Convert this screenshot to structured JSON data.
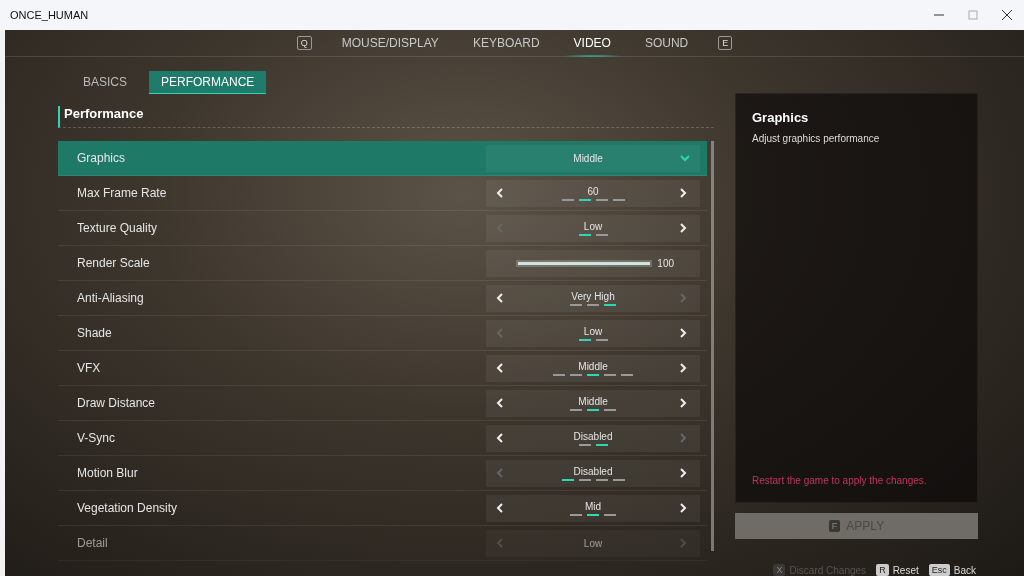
{
  "window": {
    "title": "ONCE_HUMAN"
  },
  "nav": {
    "prev_key": "Q",
    "next_key": "E",
    "tabs": [
      {
        "label": "MOUSE/DISPLAY",
        "selected": false
      },
      {
        "label": "KEYBOARD",
        "selected": false
      },
      {
        "label": "VIDEO",
        "selected": true
      },
      {
        "label": "SOUND",
        "selected": false
      }
    ]
  },
  "subtabs": [
    {
      "label": "BASICS",
      "selected": false
    },
    {
      "label": "PERFORMANCE",
      "selected": true
    }
  ],
  "section_title": "Performance",
  "settings": [
    {
      "kind": "dropdown",
      "label": "Graphics",
      "value": "Middle",
      "selected": true
    },
    {
      "kind": "stepper",
      "label": "Max Frame Rate",
      "value": "60",
      "selected": false,
      "prev_disabled": false,
      "next_disabled": false,
      "steps": [
        {
          "selected": false
        },
        {
          "selected": true
        },
        {
          "selected": false
        },
        {
          "selected": false
        }
      ]
    },
    {
      "kind": "stepper",
      "label": "Texture Quality",
      "value": "Low",
      "selected": false,
      "prev_disabled": true,
      "next_disabled": false,
      "steps": [
        {
          "selected": true
        },
        {
          "selected": false
        }
      ]
    },
    {
      "kind": "slider",
      "label": "Render Scale",
      "value": "100",
      "selected": false,
      "level": 1
    },
    {
      "kind": "stepper",
      "label": "Anti-Aliasing",
      "value": "Very High",
      "selected": false,
      "prev_disabled": false,
      "next_disabled": true,
      "steps": [
        {
          "selected": false
        },
        {
          "selected": false
        },
        {
          "selected": true
        }
      ]
    },
    {
      "kind": "stepper",
      "label": "Shade",
      "value": "Low",
      "selected": false,
      "prev_disabled": true,
      "next_disabled": false,
      "steps": [
        {
          "selected": true
        },
        {
          "selected": false
        }
      ]
    },
    {
      "kind": "stepper",
      "label": "VFX",
      "value": "Middle",
      "selected": false,
      "prev_disabled": false,
      "next_disabled": false,
      "steps": [
        {
          "selected": false
        },
        {
          "selected": false
        },
        {
          "selected": true
        },
        {
          "selected": false
        },
        {
          "selected": false
        }
      ]
    },
    {
      "kind": "stepper",
      "label": "Draw Distance",
      "value": "Middle",
      "selected": false,
      "prev_disabled": false,
      "next_disabled": false,
      "steps": [
        {
          "selected": false
        },
        {
          "selected": true
        },
        {
          "selected": false
        }
      ]
    },
    {
      "kind": "stepper",
      "label": "V-Sync",
      "value": "Disabled",
      "selected": false,
      "prev_disabled": false,
      "next_disabled": true,
      "steps": [
        {
          "selected": false
        },
        {
          "selected": true
        }
      ]
    },
    {
      "kind": "stepper",
      "label": "Motion Blur",
      "value": "Disabled",
      "selected": false,
      "prev_disabled": true,
      "next_disabled": false,
      "steps": [
        {
          "selected": true
        },
        {
          "selected": false
        },
        {
          "selected": false
        },
        {
          "selected": false
        }
      ]
    },
    {
      "kind": "stepper",
      "label": "Vegetation Density",
      "value": "Mid",
      "selected": false,
      "prev_disabled": false,
      "next_disabled": false,
      "steps": [
        {
          "selected": false
        },
        {
          "selected": true
        },
        {
          "selected": false
        }
      ]
    },
    {
      "kind": "faded",
      "label": "Detail",
      "value": "Low",
      "selected": false,
      "prev_disabled": true,
      "next_disabled": true
    }
  ],
  "info": {
    "title": "Graphics",
    "description": "Adjust graphics performance",
    "warning": "Restart the game to apply the changes."
  },
  "apply": {
    "key": "F",
    "label": "APPLY",
    "disabled": true
  },
  "footer": [
    {
      "key": "X",
      "label": "Discard Changes",
      "disabled": true
    },
    {
      "key": "R",
      "label": "Reset",
      "disabled": false
    },
    {
      "key": "Esc",
      "label": "Back",
      "disabled": false
    }
  ]
}
